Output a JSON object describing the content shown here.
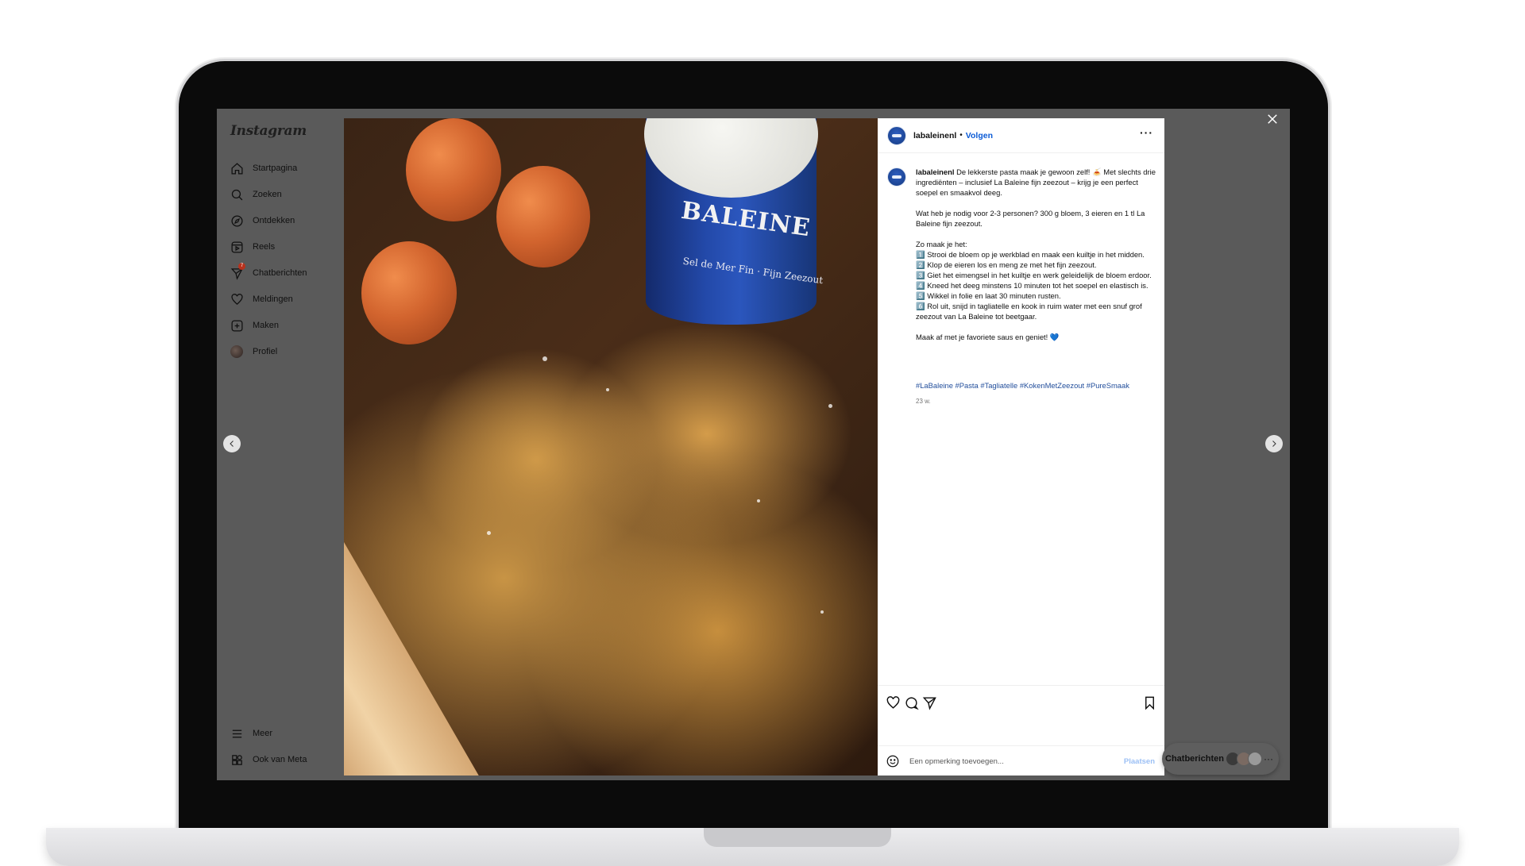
{
  "sidebar": {
    "logo": "Instagram",
    "items": [
      {
        "label": "Startpagina",
        "icon": "home-icon"
      },
      {
        "label": "Zoeken",
        "icon": "search-icon"
      },
      {
        "label": "Ontdekken",
        "icon": "compass-icon"
      },
      {
        "label": "Reels",
        "icon": "reels-icon"
      },
      {
        "label": "Chatberichten",
        "icon": "messenger-icon",
        "badge": "7"
      },
      {
        "label": "Meldingen",
        "icon": "heart-icon"
      },
      {
        "label": "Maken",
        "icon": "plus-square-icon"
      },
      {
        "label": "Profiel",
        "icon": "profile-avatar"
      }
    ],
    "bottom": [
      {
        "label": "Meer",
        "icon": "menu-icon"
      },
      {
        "label": "Ook van Meta",
        "icon": "meta-grid-icon"
      }
    ]
  },
  "post": {
    "username": "labaleinenl",
    "separator": "•",
    "follow_label": "Volgen",
    "more_label": "···",
    "caption_user": "labaleinenl",
    "caption_text": " De lekkerste pasta maak je gewoon zelf! 🍝 Met slechts drie ingrediënten – inclusief La Baleine fijn zeezout – krijg je een perfect soepel en smaakvol deeg.\n\nWat heb je nodig voor 2-3 personen? 300 g bloem, 3 eieren en 1 tl La Baleine fijn zeezout.\n\nZo maak je het:\n1️⃣ Strooi de bloem op je werkblad en maak een kuiltje in het midden.\n2️⃣ Klop de eieren los en meng ze met het fijn zeezout.\n3️⃣ Giet het eimengsel in het kuiltje en werk geleidelijk de bloem erdoor.\n4️⃣ Kneed het deeg minstens 10 minuten tot het soepel en elastisch is.\n5️⃣ Wikkel in folie en laat 30 minuten rusten.\n6️⃣ Rol uit, snijd in tagliatelle en kook in ruim water met een snuf grof zeezout van La Baleine tot beetgaar.\n\nMaak af met je favoriete saus en geniet! 💙",
    "hashtags": "#LaBaleine #Pasta #Tagliatelle #KokenMetZeezout #PureSmaak",
    "time_ago": "23 w.",
    "image_text": {
      "brand": "BALEINE",
      "sub": "Sel de Mer Fin · Fijn Zeezout"
    }
  },
  "comment": {
    "placeholder": "Een opmerking toevoegen...",
    "post_label": "Plaatsen"
  },
  "messages": {
    "label": "Chatberichten",
    "more": "···"
  },
  "colors": {
    "overlay": "#5a5a5a",
    "link_blue": "#0a5ad6",
    "hashtag_blue": "#234f9c",
    "post_button_disabled": "#9cc0f5"
  }
}
